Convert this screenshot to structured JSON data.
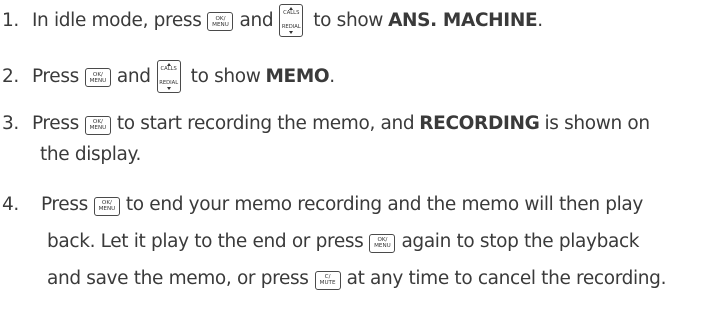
{
  "steps": [
    {
      "number": "1.",
      "text_a": "In idle mode, press",
      "text_b": "and",
      "text_c": "to show",
      "bold": "ANS. MACHINE",
      "end": "."
    },
    {
      "number": "2.",
      "text_a": "Press",
      "text_b": "and",
      "text_c": "to show",
      "bold": "MEMO",
      "end": "."
    },
    {
      "number": "3.",
      "text_a": "Press",
      "text_b": "to start recording the memo, and",
      "bold": "RECORDING",
      "text_c": "is shown on",
      "line2": "the display."
    },
    {
      "number": "4.",
      "text_a": "Press",
      "text_b": "to end your memo recording and the memo will then play",
      "line2_a": "back. Let it play to the end or press",
      "line2_b": "again to stop the playback",
      "line3_a": "and save the memo, or press",
      "line3_b": "at any time to cancel the recording."
    }
  ],
  "keys": {
    "ok_menu": {
      "top": "OK/",
      "bottom": "MENU"
    },
    "calls_redial": {
      "top": "CALLS",
      "bottom": "REDIAL"
    },
    "c_mute": {
      "top": "C/",
      "bottom": "MUTE"
    }
  }
}
